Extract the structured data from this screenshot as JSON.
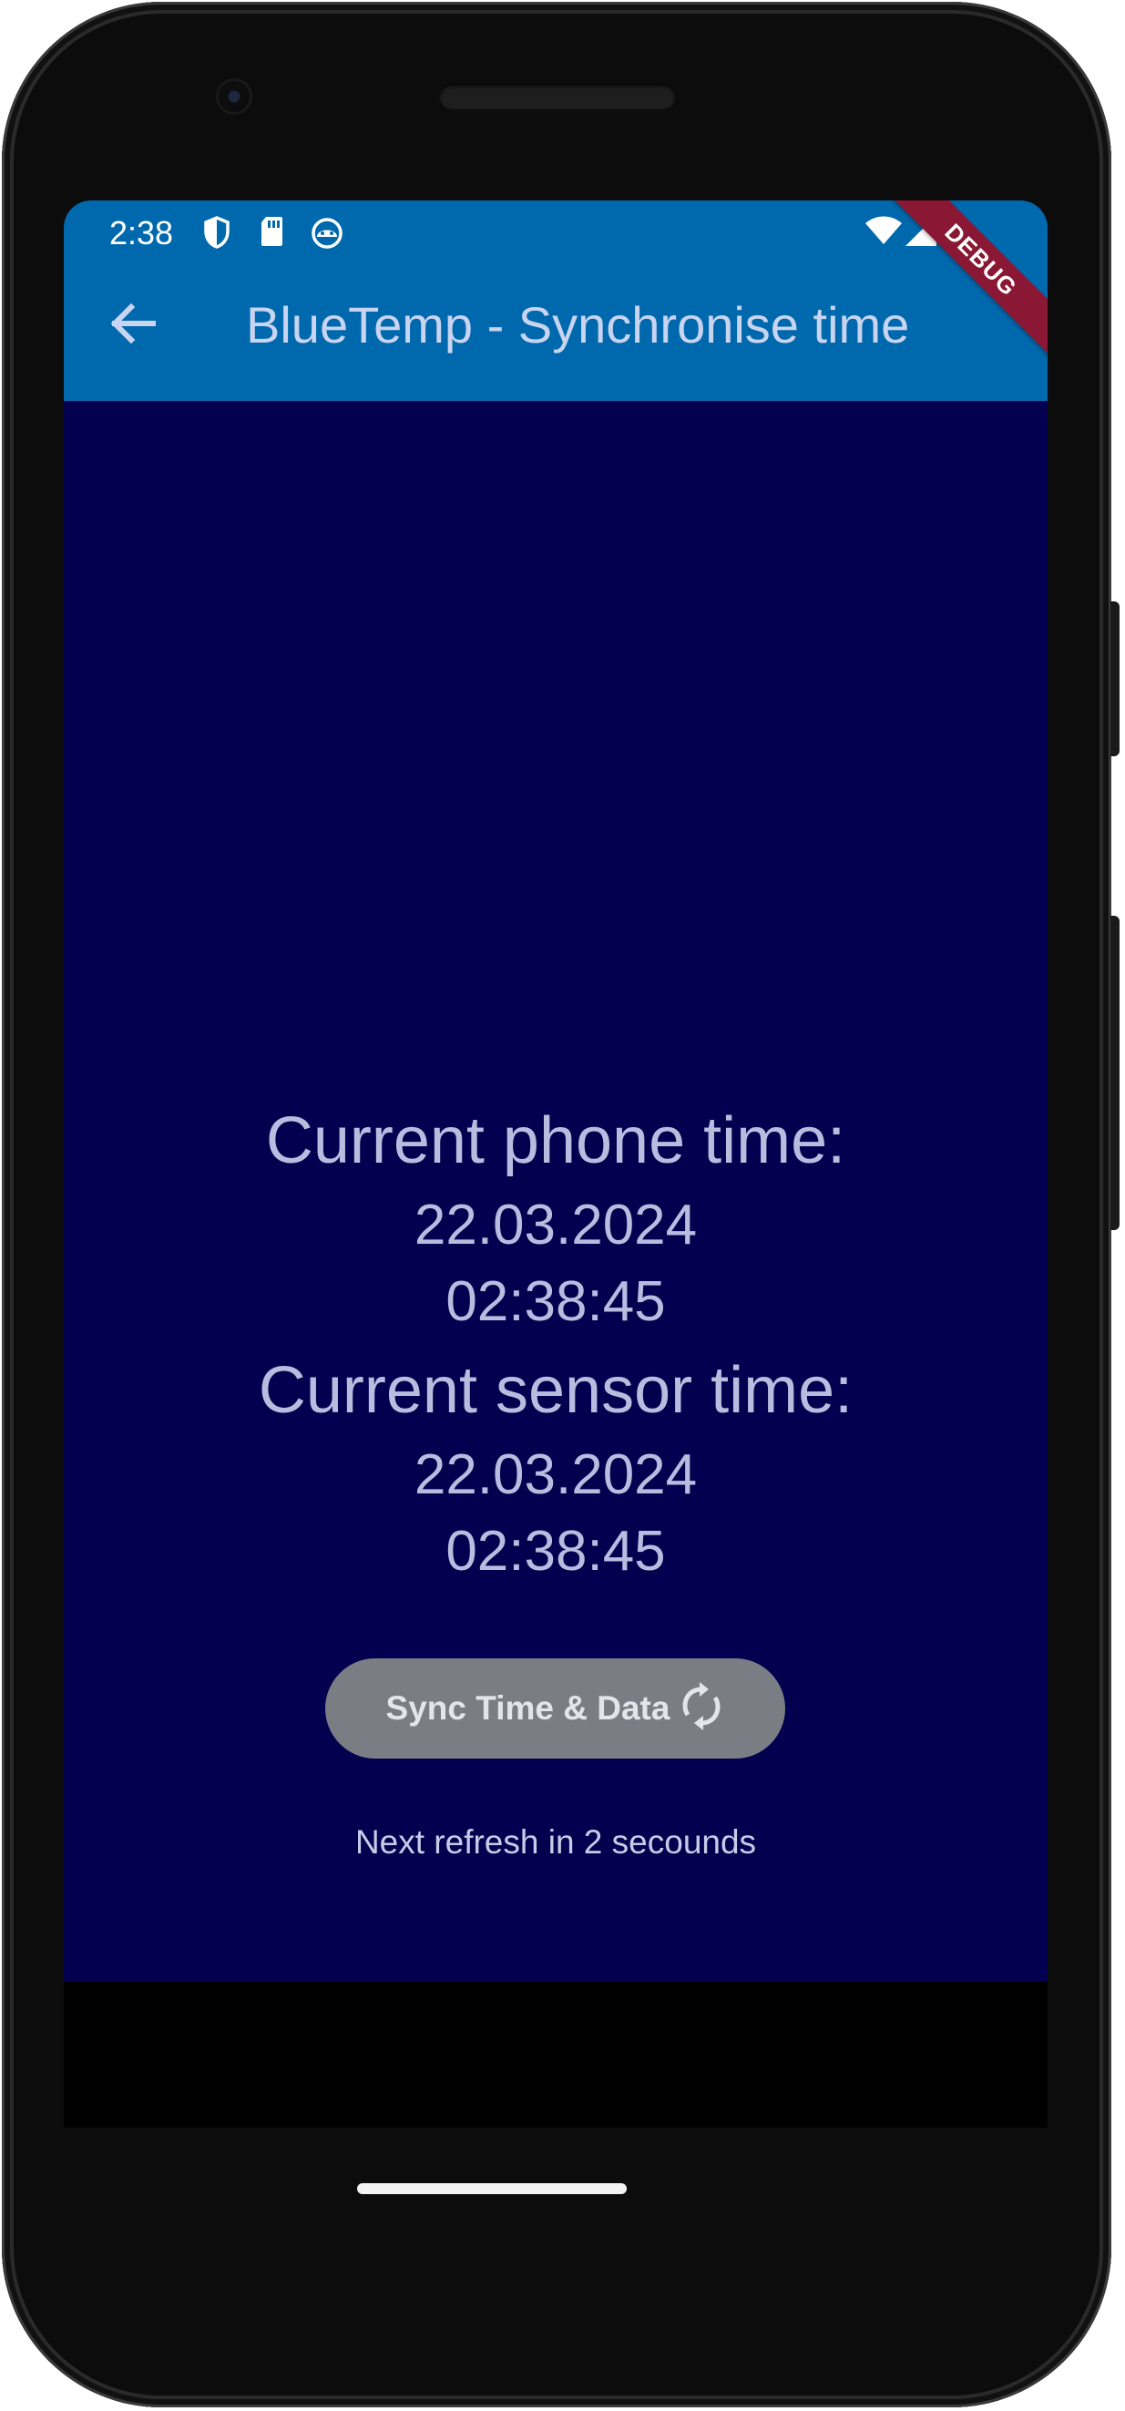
{
  "status_bar": {
    "time": "2:38",
    "icons": [
      "shield-icon",
      "sd-card-icon",
      "android-debug-icon",
      "wifi-icon",
      "cell-signal-icon"
    ]
  },
  "debug_banner": "DEBUG",
  "app_bar": {
    "back_icon": "arrow-left-icon",
    "title": "BlueTemp - Synchronise time"
  },
  "phone_time": {
    "heading": "Current phone time:",
    "date": "22.03.2024",
    "time": "02:38:45"
  },
  "sensor_time": {
    "heading": "Current sensor time:",
    "date": "22.03.2024",
    "time": "02:38:45"
  },
  "sync_button": {
    "label": "Sync Time & Data",
    "icon": "sync-icon"
  },
  "refresh_text": "Next refresh in 2 secounds",
  "colors": {
    "app_bar": "#0069ad",
    "background": "#02004f",
    "text": "#b8bde0",
    "button": "#7a7d83",
    "debug_banner": "#8a1733"
  }
}
